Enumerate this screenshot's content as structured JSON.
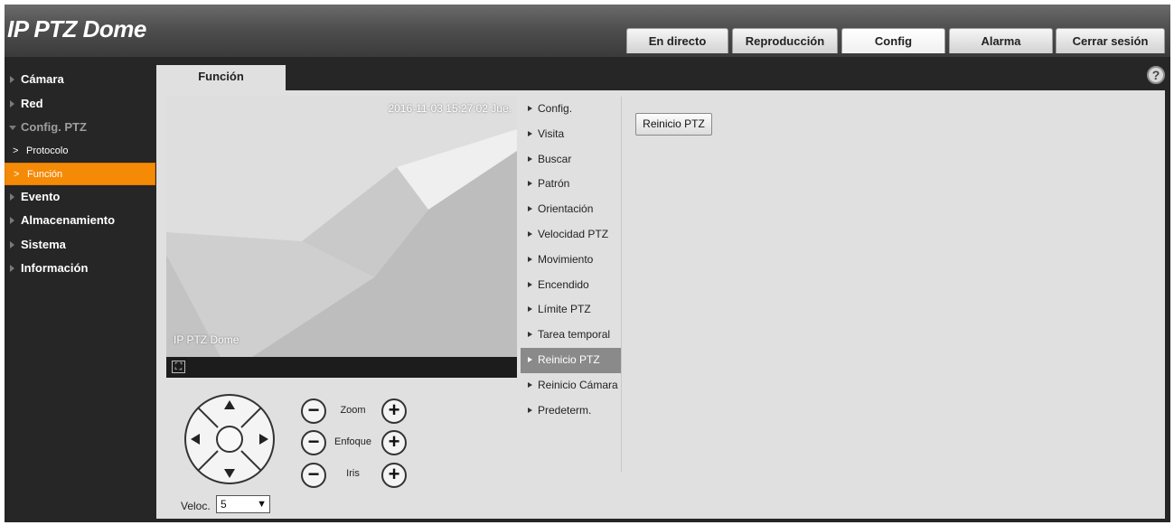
{
  "header": {
    "logo": "IP PTZ Dome",
    "tabs": [
      {
        "label": "En directo"
      },
      {
        "label": "Reproducción"
      },
      {
        "label": "Config"
      },
      {
        "label": "Alarma"
      },
      {
        "label": "Cerrar sesión"
      }
    ],
    "active_tab": "Config"
  },
  "sidebar": {
    "items": [
      {
        "label": "Cámara"
      },
      {
        "label": "Red"
      },
      {
        "label": "Config. PTZ",
        "children": [
          "Protocolo",
          "Función"
        ]
      },
      {
        "label": "Evento"
      },
      {
        "label": "Almacenamiento"
      },
      {
        "label": "Sistema"
      },
      {
        "label": "Información"
      }
    ],
    "active_child": "Función"
  },
  "content": {
    "tab": "Función",
    "help_icon": "?"
  },
  "video": {
    "timestamp": "2016-11-03 15:27:02 Jue.",
    "channel": "IP PTZ Dome",
    "fullscreen_icon": "fullscreen-icon"
  },
  "ptz": {
    "zoom_label": "Zoom",
    "focus_label": "Enfoque",
    "iris_label": "Iris",
    "minus": "−",
    "plus": "+",
    "speed_label": "Veloc.",
    "speed_value": "5"
  },
  "menu": {
    "items": [
      "Config.",
      "Visita",
      "Buscar",
      "Patrón",
      "Orientación",
      "Velocidad PTZ",
      "Movimiento",
      "Encendido",
      "Límite PTZ",
      "Tarea temporal",
      "Reinicio PTZ",
      "Reinicio Cámara",
      "Predeterm."
    ],
    "active": "Reinicio PTZ"
  },
  "action": {
    "reset_button": "Reinicio PTZ"
  }
}
